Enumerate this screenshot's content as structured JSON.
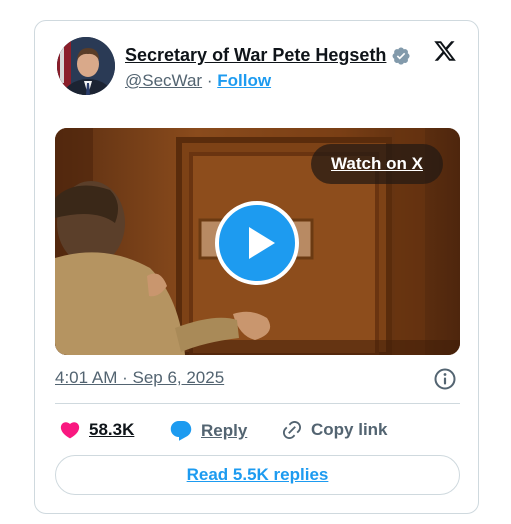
{
  "author": {
    "name": "Secretary of War Pete Hegseth",
    "handle": "@SecWar",
    "separator": "·",
    "follow_label": "Follow",
    "verified_icon": "verified-badge-icon"
  },
  "media": {
    "watch_label": "Watch on X",
    "play_icon": "play-icon"
  },
  "timestamp": "4:01 AM · Sep 6, 2025",
  "actions": {
    "likes": "58.3K",
    "reply_label": "Reply",
    "copy_label": "Copy link"
  },
  "read_replies_label": "Read 5.5K replies",
  "colors": {
    "accent": "#1d9bf0",
    "like": "#f91880",
    "text": "#0f1419",
    "muted": "#536471",
    "border": "#cfd9de"
  }
}
